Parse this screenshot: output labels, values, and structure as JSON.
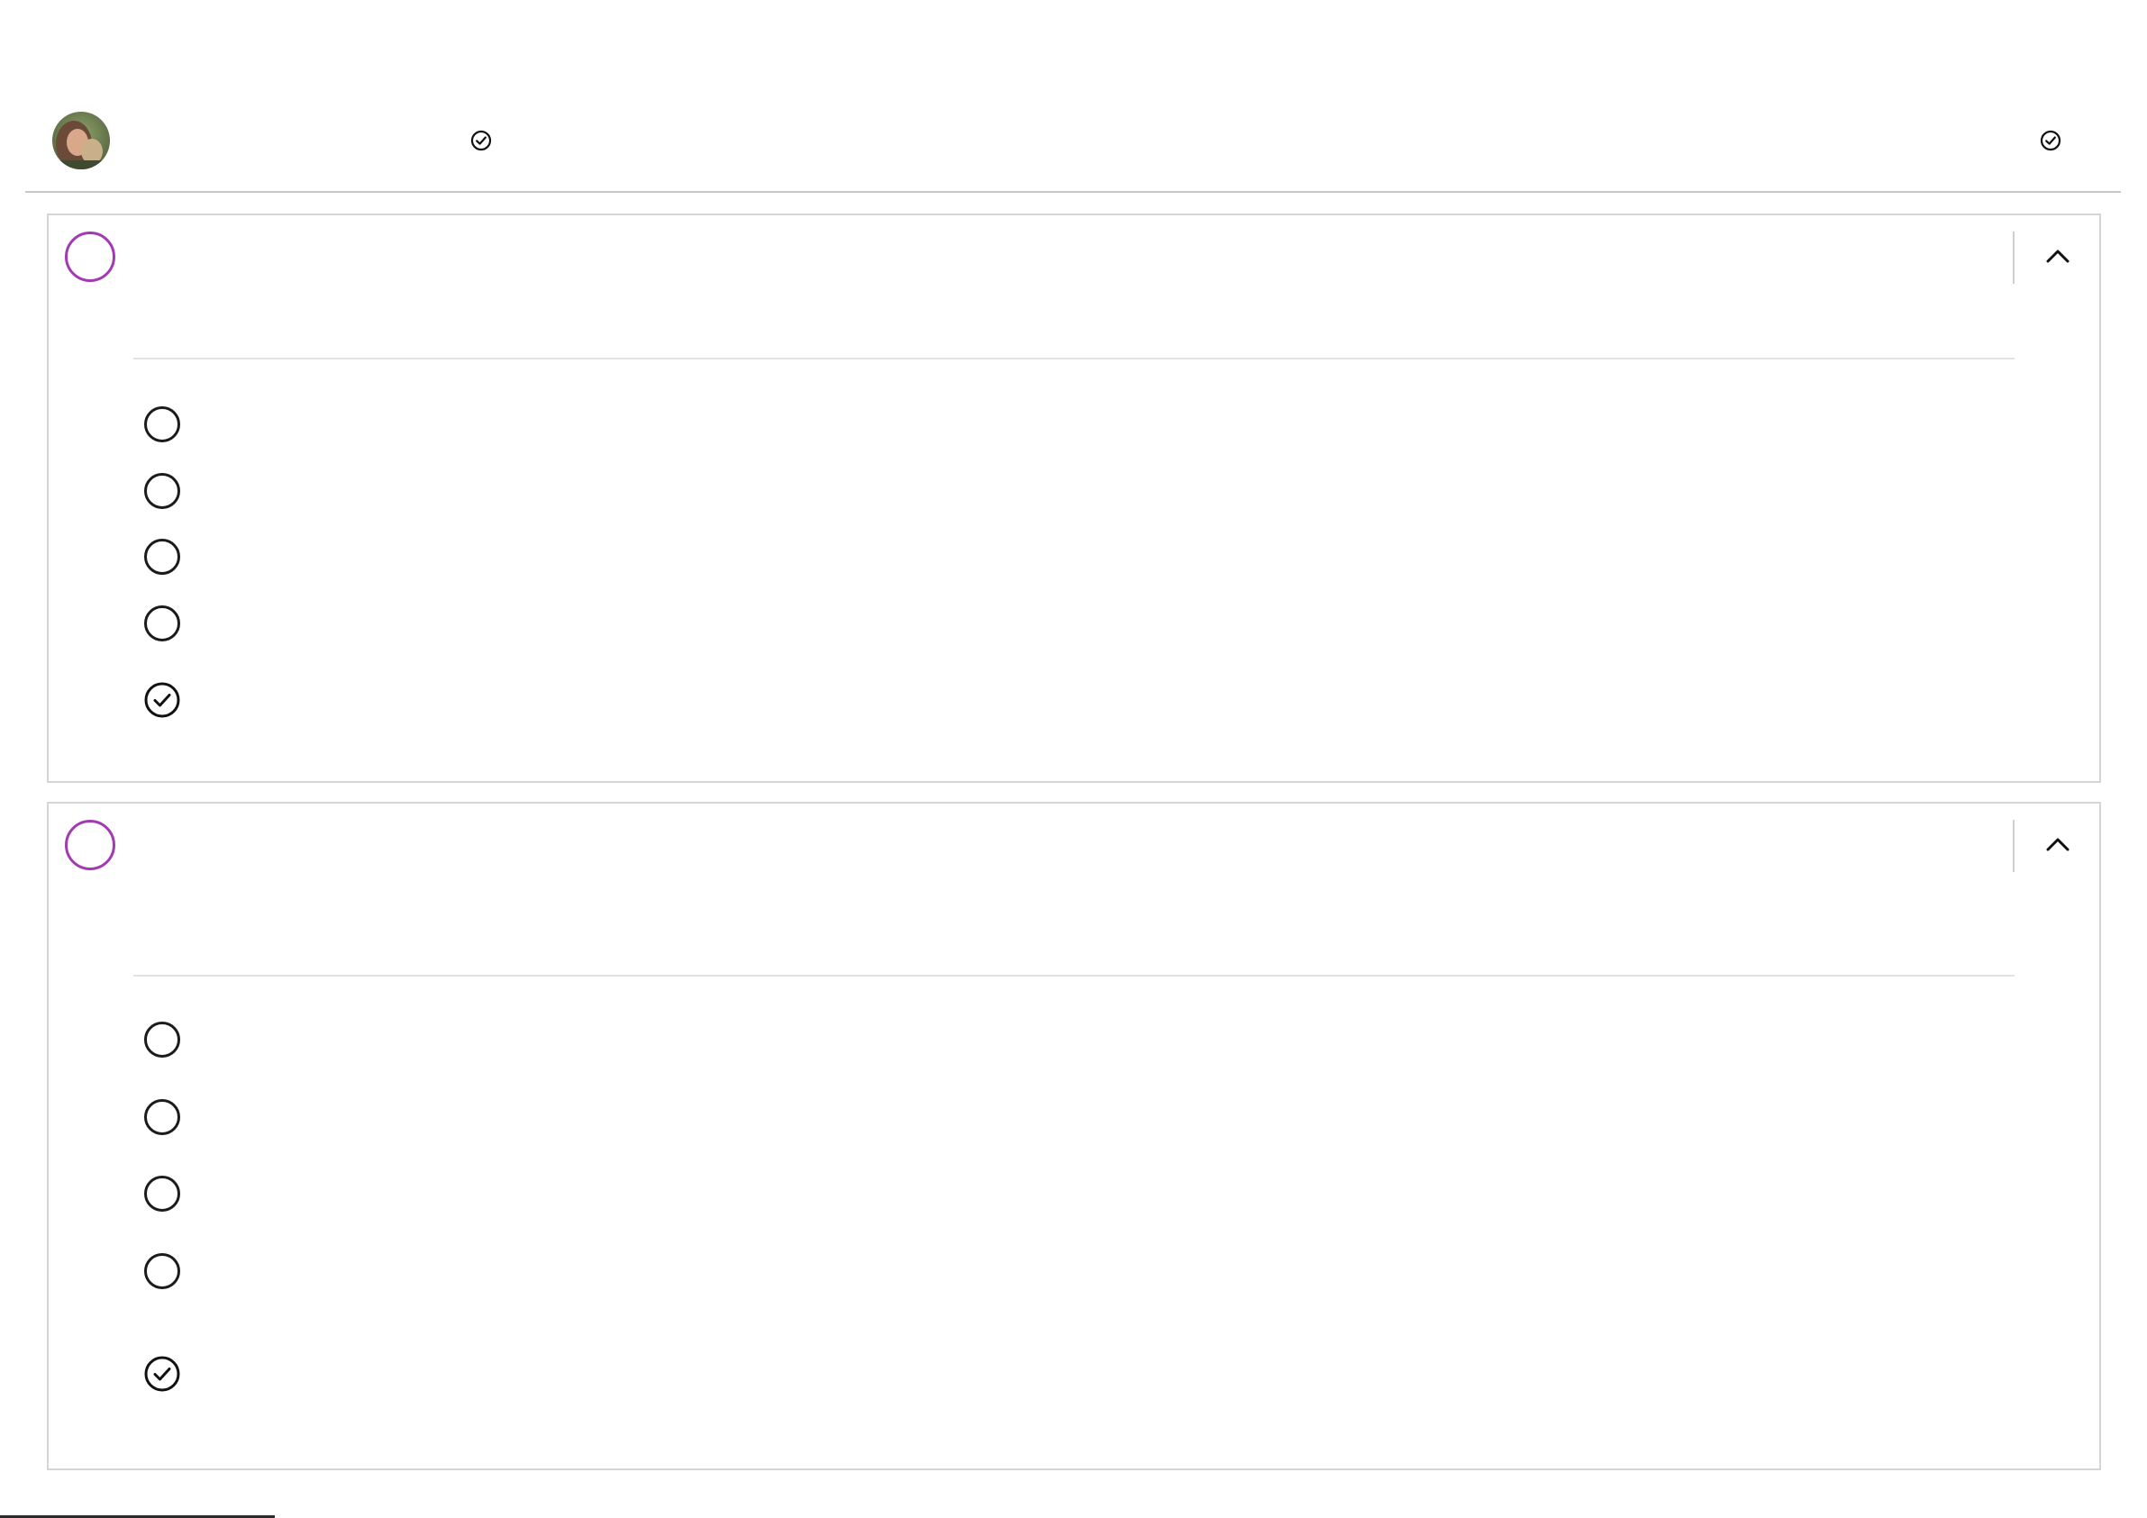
{
  "header": {
    "avatar": "user-avatar-photo",
    "responder_name": "",
    "left_check_icon": "check-circle-icon",
    "left_status": "",
    "right_check_icon": "check-circle-icon",
    "right_status": ""
  },
  "questions": [
    {
      "number": "",
      "text": "",
      "collapse_icon": "chevron-up-icon",
      "options": [
        {
          "label": "",
          "selected": false
        },
        {
          "label": "",
          "selected": false
        },
        {
          "label": "",
          "selected": false
        },
        {
          "label": "",
          "selected": false
        },
        {
          "label": "",
          "selected": true
        }
      ]
    },
    {
      "number": "",
      "text": "",
      "collapse_icon": "chevron-up-icon",
      "options": [
        {
          "label": "",
          "selected": false
        },
        {
          "label": "",
          "selected": false
        },
        {
          "label": "",
          "selected": false
        },
        {
          "label": "",
          "selected": false
        },
        {
          "label": "",
          "selected": true
        }
      ]
    }
  ],
  "colors": {
    "accent": "#a33ab4",
    "text": "#1b1b1b",
    "border": "#d6d6d6"
  }
}
